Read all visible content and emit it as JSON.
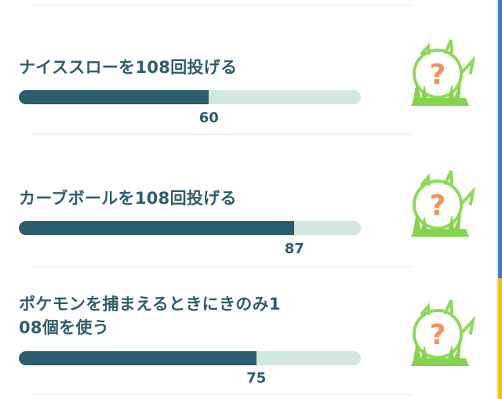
{
  "tasks": [
    {
      "title": "ナイススローを108回投げる",
      "progress": 60,
      "goal": 108,
      "progress_label": "60",
      "reward_icon": "mystery-encounter-grass-icon"
    },
    {
      "title": "カーブボールを108回投げる",
      "progress": 87,
      "goal": 108,
      "progress_label": "87",
      "reward_icon": "mystery-encounter-grass-icon"
    },
    {
      "title": "ポケモンを捕まえるときにきのみ1\n08個を使う",
      "title_lines": [
        "ポケモンを捕まえるときにきのみ1",
        "08個を使う"
      ],
      "progress": 75,
      "goal": 108,
      "progress_label": "75",
      "reward_icon": "mystery-encounter-grass-icon"
    }
  ],
  "reward_symbol": "?",
  "colors": {
    "bar_fill": "#2a5d6e",
    "bar_track": "#d1e7df",
    "text": "#2f5d6b",
    "question": "#f0945c",
    "grass": "#86d34f"
  }
}
